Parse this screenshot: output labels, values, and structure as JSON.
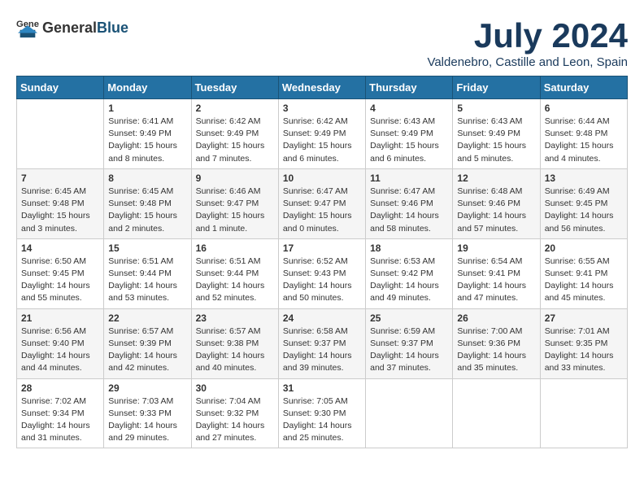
{
  "logo": {
    "general": "General",
    "blue": "Blue"
  },
  "title": "July 2024",
  "subtitle": "Valdenebro, Castille and Leon, Spain",
  "days_header": [
    "Sunday",
    "Monday",
    "Tuesday",
    "Wednesday",
    "Thursday",
    "Friday",
    "Saturday"
  ],
  "weeks": [
    [
      {
        "day": "",
        "info": ""
      },
      {
        "day": "1",
        "info": "Sunrise: 6:41 AM\nSunset: 9:49 PM\nDaylight: 15 hours\nand 8 minutes."
      },
      {
        "day": "2",
        "info": "Sunrise: 6:42 AM\nSunset: 9:49 PM\nDaylight: 15 hours\nand 7 minutes."
      },
      {
        "day": "3",
        "info": "Sunrise: 6:42 AM\nSunset: 9:49 PM\nDaylight: 15 hours\nand 6 minutes."
      },
      {
        "day": "4",
        "info": "Sunrise: 6:43 AM\nSunset: 9:49 PM\nDaylight: 15 hours\nand 6 minutes."
      },
      {
        "day": "5",
        "info": "Sunrise: 6:43 AM\nSunset: 9:49 PM\nDaylight: 15 hours\nand 5 minutes."
      },
      {
        "day": "6",
        "info": "Sunrise: 6:44 AM\nSunset: 9:48 PM\nDaylight: 15 hours\nand 4 minutes."
      }
    ],
    [
      {
        "day": "7",
        "info": "Sunrise: 6:45 AM\nSunset: 9:48 PM\nDaylight: 15 hours\nand 3 minutes."
      },
      {
        "day": "8",
        "info": "Sunrise: 6:45 AM\nSunset: 9:48 PM\nDaylight: 15 hours\nand 2 minutes."
      },
      {
        "day": "9",
        "info": "Sunrise: 6:46 AM\nSunset: 9:47 PM\nDaylight: 15 hours\nand 1 minute."
      },
      {
        "day": "10",
        "info": "Sunrise: 6:47 AM\nSunset: 9:47 PM\nDaylight: 15 hours\nand 0 minutes."
      },
      {
        "day": "11",
        "info": "Sunrise: 6:47 AM\nSunset: 9:46 PM\nDaylight: 14 hours\nand 58 minutes."
      },
      {
        "day": "12",
        "info": "Sunrise: 6:48 AM\nSunset: 9:46 PM\nDaylight: 14 hours\nand 57 minutes."
      },
      {
        "day": "13",
        "info": "Sunrise: 6:49 AM\nSunset: 9:45 PM\nDaylight: 14 hours\nand 56 minutes."
      }
    ],
    [
      {
        "day": "14",
        "info": "Sunrise: 6:50 AM\nSunset: 9:45 PM\nDaylight: 14 hours\nand 55 minutes."
      },
      {
        "day": "15",
        "info": "Sunrise: 6:51 AM\nSunset: 9:44 PM\nDaylight: 14 hours\nand 53 minutes."
      },
      {
        "day": "16",
        "info": "Sunrise: 6:51 AM\nSunset: 9:44 PM\nDaylight: 14 hours\nand 52 minutes."
      },
      {
        "day": "17",
        "info": "Sunrise: 6:52 AM\nSunset: 9:43 PM\nDaylight: 14 hours\nand 50 minutes."
      },
      {
        "day": "18",
        "info": "Sunrise: 6:53 AM\nSunset: 9:42 PM\nDaylight: 14 hours\nand 49 minutes."
      },
      {
        "day": "19",
        "info": "Sunrise: 6:54 AM\nSunset: 9:41 PM\nDaylight: 14 hours\nand 47 minutes."
      },
      {
        "day": "20",
        "info": "Sunrise: 6:55 AM\nSunset: 9:41 PM\nDaylight: 14 hours\nand 45 minutes."
      }
    ],
    [
      {
        "day": "21",
        "info": "Sunrise: 6:56 AM\nSunset: 9:40 PM\nDaylight: 14 hours\nand 44 minutes."
      },
      {
        "day": "22",
        "info": "Sunrise: 6:57 AM\nSunset: 9:39 PM\nDaylight: 14 hours\nand 42 minutes."
      },
      {
        "day": "23",
        "info": "Sunrise: 6:57 AM\nSunset: 9:38 PM\nDaylight: 14 hours\nand 40 minutes."
      },
      {
        "day": "24",
        "info": "Sunrise: 6:58 AM\nSunset: 9:37 PM\nDaylight: 14 hours\nand 39 minutes."
      },
      {
        "day": "25",
        "info": "Sunrise: 6:59 AM\nSunset: 9:37 PM\nDaylight: 14 hours\nand 37 minutes."
      },
      {
        "day": "26",
        "info": "Sunrise: 7:00 AM\nSunset: 9:36 PM\nDaylight: 14 hours\nand 35 minutes."
      },
      {
        "day": "27",
        "info": "Sunrise: 7:01 AM\nSunset: 9:35 PM\nDaylight: 14 hours\nand 33 minutes."
      }
    ],
    [
      {
        "day": "28",
        "info": "Sunrise: 7:02 AM\nSunset: 9:34 PM\nDaylight: 14 hours\nand 31 minutes."
      },
      {
        "day": "29",
        "info": "Sunrise: 7:03 AM\nSunset: 9:33 PM\nDaylight: 14 hours\nand 29 minutes."
      },
      {
        "day": "30",
        "info": "Sunrise: 7:04 AM\nSunset: 9:32 PM\nDaylight: 14 hours\nand 27 minutes."
      },
      {
        "day": "31",
        "info": "Sunrise: 7:05 AM\nSunset: 9:30 PM\nDaylight: 14 hours\nand 25 minutes."
      },
      {
        "day": "",
        "info": ""
      },
      {
        "day": "",
        "info": ""
      },
      {
        "day": "",
        "info": ""
      }
    ]
  ]
}
